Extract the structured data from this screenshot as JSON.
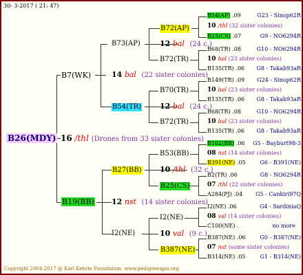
{
  "header": "30-  3-2017  ( 21:  47)",
  "footer": "Copyright 2004-2017 @ Karl Kehrle Foundation.   www.pedigreeapis.org",
  "root": {
    "name": "B26(MDY)",
    "year": "16",
    "mark": "/thl",
    "note": "(Drones from 33 sister colonies)"
  },
  "l1": {
    "b7": "B7(WK)",
    "b19": "B19(BB)"
  },
  "m_b7": {
    "year": "14",
    "mark": "bal",
    "note": "(22 sister colonies)"
  },
  "m_b19": {
    "year": "12",
    "mark": "nst",
    "note": "(14 sister colonies)"
  },
  "l2": {
    "b73": "B73(AP)",
    "b54": "B54(TR)",
    "b27": "B27(BB)",
    "i2": "I2(NE)"
  },
  "l3": {
    "b72ap": "B72(AP)",
    "b72tr1": "B72(TR)",
    "b70tr": "B70(TR)",
    "b72tr2": "B72(TR)",
    "b53": "B53(BB)",
    "b25cs": "B25(CS)",
    "i2ne": "I2(NE)",
    "b387ne": "B387(NE)"
  },
  "m_b73": {
    "year": "12",
    "mark": "bal",
    "note": "(24 c.)"
  },
  "m_b54": {
    "year": "12",
    "mark": "bal",
    "note": "(24 c.)"
  },
  "m_b27": {
    "year": "10",
    "mark": "/thl",
    "note": "(32 c.)"
  },
  "m_i2": {
    "year": "10",
    "mark": "val",
    "note": "(9 c.)"
  },
  "right": [
    {
      "type": "q",
      "name": "B54(AP)",
      "year": ".09",
      "tail": "G23 - Sinop62R",
      "hl": "g"
    },
    {
      "type": "m",
      "year": "10",
      "mark": "/thl",
      "note": "(32 sister colonies)"
    },
    {
      "type": "q",
      "name": "B25(CS)",
      "year": ".07",
      "tail": "G9 - NO6294R",
      "hl": "g"
    },
    {
      "type": "q",
      "name": "B68(TR)",
      "year": ".08",
      "tail": "G10 - NO6294R"
    },
    {
      "type": "m",
      "year": "10",
      "mark": "bal",
      "note": "(23 sister colonies)"
    },
    {
      "type": "q",
      "name": "B135(TR)",
      "year": ".06",
      "tail": "G8 - Takab93aR"
    },
    {
      "type": "q",
      "name": "B149(TR)",
      "year": ".09",
      "tail": "G24 - Sinop62R"
    },
    {
      "type": "m",
      "year": "10",
      "mark": "bal",
      "note": "(23 sister colonies)"
    },
    {
      "type": "q",
      "name": "B135(TR)",
      "year": ".06",
      "tail": "G8 - Takab93aR"
    },
    {
      "type": "q",
      "name": "B68(TR)",
      "year": ".08",
      "tail": "G10 - NO6294R"
    },
    {
      "type": "m",
      "year": "10",
      "mark": "bal",
      "note": "(23 sister colonies)"
    },
    {
      "type": "q",
      "name": "B135(TR)",
      "year": ".06",
      "tail": "G8 - Takab93aR"
    },
    {
      "type": "q",
      "name": "B102(BB)",
      "year": ".06",
      "tail": "G5 - Bayburt98-3",
      "hl": "g"
    },
    {
      "type": "m",
      "year": "08",
      "mark": "nst",
      "note": "(14 sister colonies)"
    },
    {
      "type": "q",
      "name": "B391(NE)",
      "year": ".05",
      "tail": "G6 - B391(NE)",
      "hl": "y"
    },
    {
      "type": "q",
      "name": "B2(TR)",
      "year": ".06",
      "tail": "G8 - NO6294R"
    },
    {
      "type": "m",
      "year": "07",
      "mark": "/thl",
      "note": "(22 sister colonies)"
    },
    {
      "type": "q",
      "name": "A284(PJ)",
      "year": ".04",
      "tail": "G5 - Cankiri97Q"
    },
    {
      "type": "q",
      "name": "I2(NE)",
      "year": ".06",
      "tail": "G4 - SardiniaQ"
    },
    {
      "type": "m",
      "year": "08",
      "mark": "val",
      "note": "(14 sister colonies)"
    },
    {
      "type": "q",
      "name": "C100(NE)",
      "year": ".",
      "tail": "no more"
    },
    {
      "type": "q",
      "name": "B387(NE)",
      "year": ".06",
      "tail": "G0 - B387(NE)"
    },
    {
      "type": "m",
      "year": "07",
      "mark": "nst",
      "note": "(some sister colonies)"
    },
    {
      "type": "q",
      "name": "B314(NE)",
      "year": ".05",
      "tail": "G1 - B314(NE)"
    }
  ]
}
